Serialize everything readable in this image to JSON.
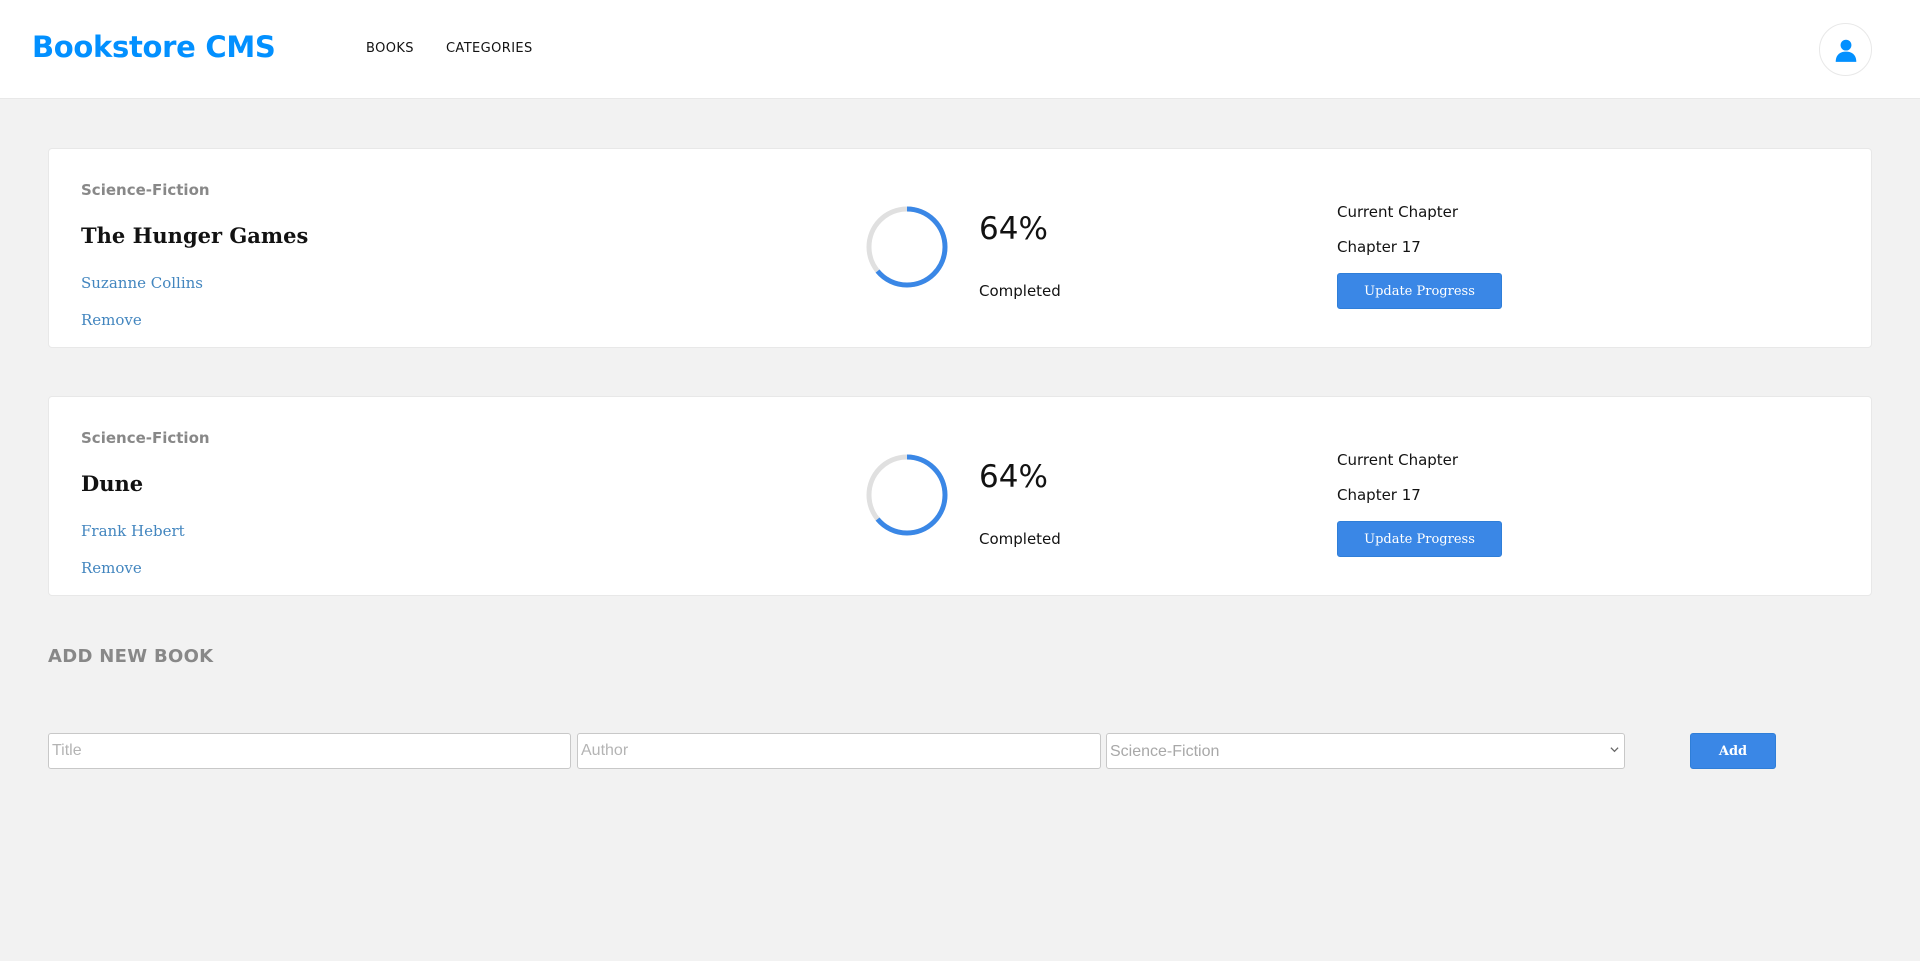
{
  "header": {
    "brand": "Bookstore CMS",
    "nav": [
      {
        "label": "BOOKS"
      },
      {
        "label": "CATEGORIES"
      }
    ],
    "avatar_icon": "user-icon"
  },
  "books": [
    {
      "category": "Science-Fiction",
      "title": "The Hunger Games",
      "author": "Suzanne Collins",
      "remove_label": "Remove",
      "progress": 0.64,
      "percent_label": "64%",
      "completed_label": "Completed",
      "chapter_label": "Current Chapter",
      "chapter_value": "Chapter 17",
      "update_label": "Update Progress"
    },
    {
      "category": "Science-Fiction",
      "title": "Dune",
      "author": "Frank Hebert",
      "remove_label": "Remove",
      "progress": 0.64,
      "percent_label": "64%",
      "completed_label": "Completed",
      "chapter_label": "Current Chapter",
      "chapter_value": "Chapter 17",
      "update_label": "Update Progress"
    }
  ],
  "add_form": {
    "heading": "ADD NEW BOOK",
    "title_placeholder": "Title",
    "author_placeholder": "Author",
    "category_selected": "Science-Fiction",
    "add_label": "Add"
  },
  "colors": {
    "brand": "#0290ff",
    "accent": "#3a87e6",
    "ring_track": "#e0e0e0",
    "link": "#4386bf"
  }
}
